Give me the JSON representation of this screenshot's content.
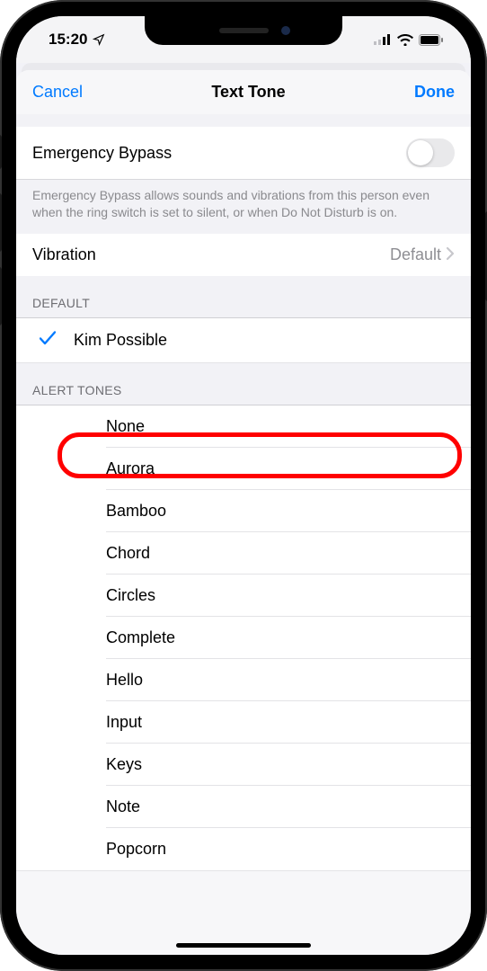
{
  "status": {
    "time": "15:20"
  },
  "nav": {
    "cancel": "Cancel",
    "title": "Text Tone",
    "done": "Done"
  },
  "emergency": {
    "label": "Emergency Bypass",
    "footer": "Emergency Bypass allows sounds and vibrations from this person even when the ring switch is set to silent, or when Do Not Disturb is on.",
    "on": false
  },
  "vibration": {
    "label": "Vibration",
    "value": "Default"
  },
  "sections": {
    "default_header": "DEFAULT",
    "default_item": "Kim Possible",
    "alert_header": "ALERT TONES",
    "alert_tones": [
      "None",
      "Aurora",
      "Bamboo",
      "Chord",
      "Circles",
      "Complete",
      "Hello",
      "Input",
      "Keys",
      "Note",
      "Popcorn"
    ]
  },
  "highlighted": "Chord"
}
